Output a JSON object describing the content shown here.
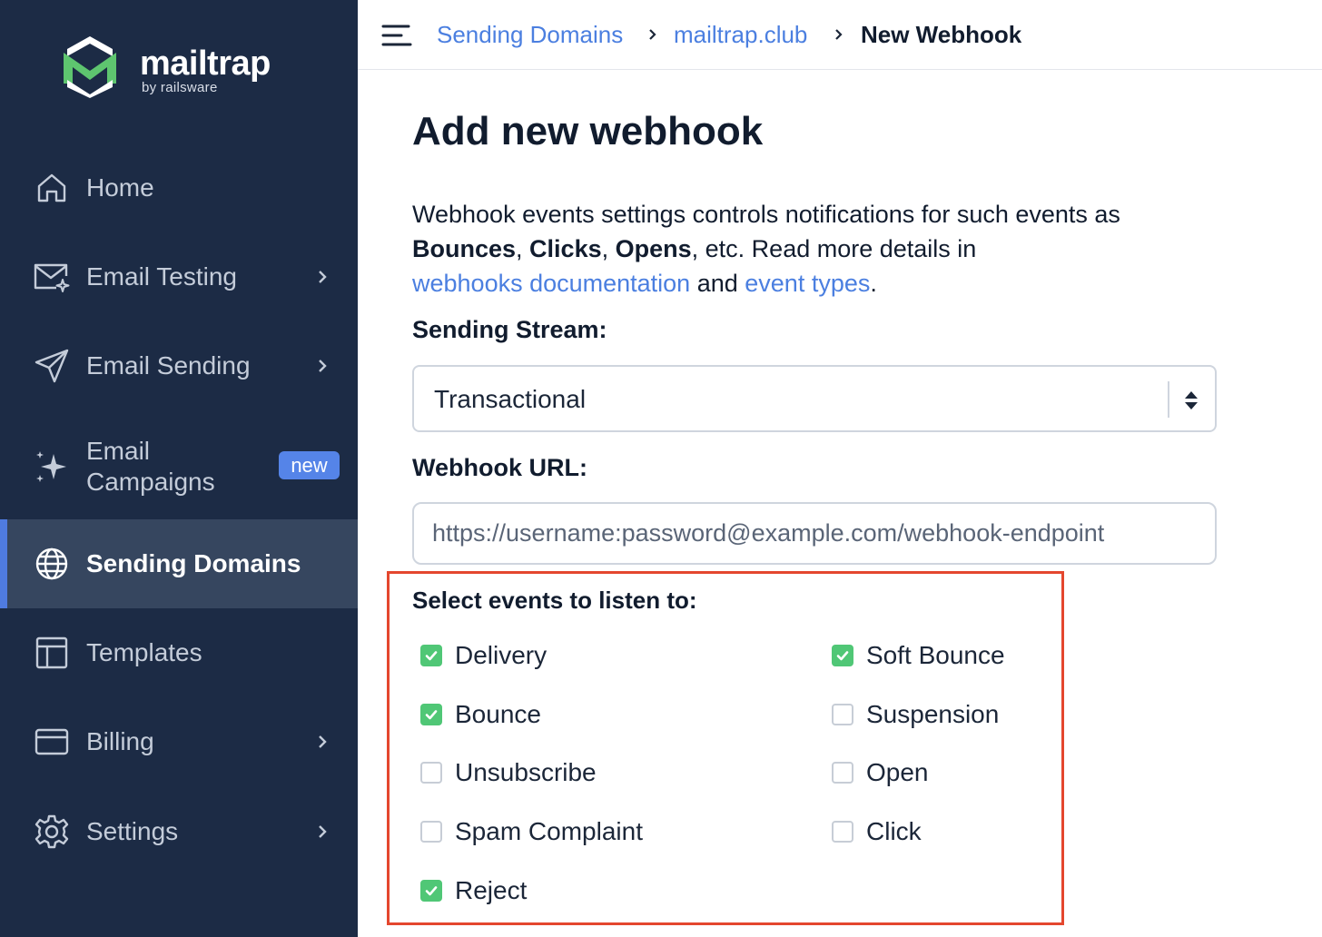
{
  "sidebar": {
    "logo": {
      "word": "mailtrap",
      "sub": "by railsware",
      "mark_color": "#5ec56f"
    },
    "items": [
      {
        "label": "Home",
        "icon": "home-icon",
        "chevron": false
      },
      {
        "label": "Email Testing",
        "icon": "envelope-sparkle-icon",
        "chevron": true
      },
      {
        "label": "Email Sending",
        "icon": "paper-plane-icon",
        "chevron": true
      },
      {
        "label": "Email Campaigns",
        "icon": "sparkle-icon",
        "chevron": false,
        "badge": "new"
      },
      {
        "label": "Sending Domains",
        "icon": "globe-icon",
        "chevron": false,
        "active": true
      },
      {
        "label": "Templates",
        "icon": "template-layout-icon",
        "chevron": false
      },
      {
        "label": "Billing",
        "icon": "credit-card-icon",
        "chevron": true
      },
      {
        "label": "Settings",
        "icon": "gear-icon",
        "chevron": true
      }
    ]
  },
  "breadcrumb": {
    "items": [
      "Sending Domains",
      "mailtrap.club",
      "New Webhook"
    ]
  },
  "page": {
    "title": "Add new webhook",
    "desc": {
      "part1": "Webhook events settings controls notifications for such events as ",
      "b1": "Bounces",
      "sep1": ", ",
      "b2": "Clicks",
      "sep2": ", ",
      "b3": "Opens",
      "part2": ", etc. Read more details in ",
      "link1": "webhooks documentation",
      "part3": " and ",
      "link2": "event types",
      "part4": "."
    },
    "stream_label": "Sending Stream:",
    "stream_value": "Transactional",
    "url_label": "Webhook URL:",
    "url_placeholder": "https://username:password@example.com/webhook-endpoint",
    "events_title": "Select events to listen to:",
    "events": [
      {
        "label": "Delivery",
        "checked": true
      },
      {
        "label": "Soft Bounce",
        "checked": true
      },
      {
        "label": "Bounce",
        "checked": true
      },
      {
        "label": "Suspension",
        "checked": false
      },
      {
        "label": "Unsubscribe",
        "checked": false
      },
      {
        "label": "Open",
        "checked": false
      },
      {
        "label": "Spam Complaint",
        "checked": false
      },
      {
        "label": "Click",
        "checked": false
      },
      {
        "label": "Reject",
        "checked": true
      }
    ]
  },
  "colors": {
    "sidebar_bg": "#1c2b45",
    "active_bg": "#36465f",
    "link": "#4b7fe0",
    "checkbox_checked": "#50c776",
    "highlight_border": "#e4472e"
  }
}
